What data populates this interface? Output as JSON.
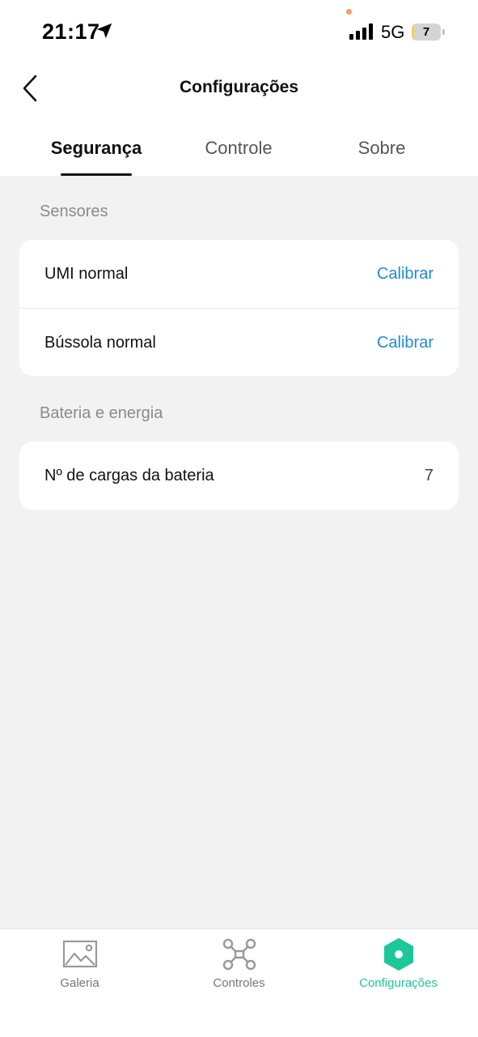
{
  "status_bar": {
    "time": "21:17",
    "network": "5G",
    "battery_level": "7",
    "battery_fraction": 0.07
  },
  "header": {
    "title": "Configurações"
  },
  "tabs": [
    {
      "label": "Segurança",
      "active": true
    },
    {
      "label": "Controle",
      "active": false
    },
    {
      "label": "Sobre",
      "active": false
    }
  ],
  "sensors": {
    "section_label": "Sensores",
    "rows": [
      {
        "label": "UMI normal",
        "action": "Calibrar"
      },
      {
        "label": "Bússola normal",
        "action": "Calibrar"
      }
    ]
  },
  "battery_energy": {
    "section_label": "Bateria e energia",
    "rows": [
      {
        "label": "Nº de cargas da bateria",
        "value": "7"
      }
    ]
  },
  "bottom_nav": [
    {
      "label": "Galeria",
      "icon": "gallery-icon",
      "active": false
    },
    {
      "label": "Controles",
      "icon": "drone-icon",
      "active": false
    },
    {
      "label": "Configurações",
      "icon": "settings-hexagon-icon",
      "active": true
    }
  ],
  "colors": {
    "accent_link": "#1e8bd6",
    "accent_active_nav": "#1ec79a",
    "background": "#f2f2f2"
  }
}
